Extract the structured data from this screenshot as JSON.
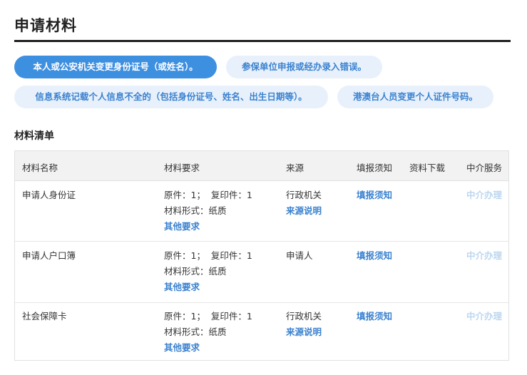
{
  "page_title": "申请材料",
  "tabs": [
    {
      "label": "本人或公安机关变更身份证号（或姓名）。",
      "active": true
    },
    {
      "label": "参保单位申报或经办录入错误。",
      "active": false
    },
    {
      "label": "信息系统记载个人信息不全的（包括身份证号、姓名、出生日期等）。",
      "active": false
    },
    {
      "label": "港澳台人员变更个人证件号码。",
      "active": false
    }
  ],
  "section_title": "材料清单",
  "table": {
    "headers": [
      "材料名称",
      "材料要求",
      "来源",
      "填报须知",
      "资料下载",
      "中介服务"
    ],
    "rows": [
      {
        "name": "申请人身份证",
        "req_line1": "原件：1；  复印件：1",
        "req_line2": "材料形式：纸质",
        "req_link": "其他要求",
        "source": "行政机关",
        "source_link": "来源说明",
        "notice": "填报须知",
        "agency": "中介办理"
      },
      {
        "name": "申请人户口簿",
        "req_line1": "原件：1；  复印件：1",
        "req_line2": "材料形式：纸质",
        "req_link": "其他要求",
        "source": "申请人",
        "source_link": "",
        "notice": "填报须知",
        "agency": "中介办理"
      },
      {
        "name": "社会保障卡",
        "req_line1": "原件：1；  复印件：1",
        "req_line2": "材料形式：纸质",
        "req_link": "其他要求",
        "source": "行政机关",
        "source_link": "来源说明",
        "notice": "填报须知",
        "agency": "中介办理"
      }
    ]
  },
  "colors": {
    "accent": "#3d8fe0",
    "pill_bg": "#e8f1fb",
    "link": "#3b82d0",
    "disabled_link": "#bcd6f0"
  }
}
